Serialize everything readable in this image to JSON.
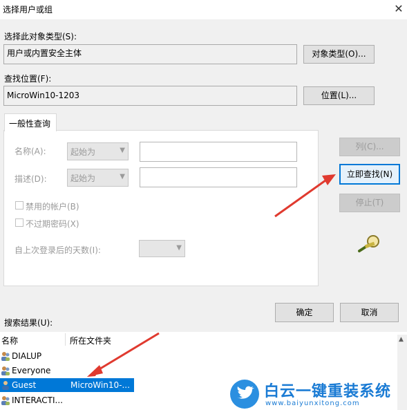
{
  "window": {
    "title": "选择用户或组",
    "close_glyph": "✕"
  },
  "object_type": {
    "label": "选择此对象类型(S):",
    "value": "用户或内置安全主体",
    "button": "对象类型(O)..."
  },
  "location": {
    "label": "查找位置(F):",
    "value": "MicroWin10-1203",
    "button": "位置(L)..."
  },
  "query": {
    "tab_label": "一般性查询",
    "name_label": "名称(A):",
    "name_mode": "起始为",
    "desc_label": "描述(D):",
    "desc_mode": "起始为",
    "disabled_accounts": "禁用的帐户(B)",
    "non_expiring_pw": "不过期密码(X)",
    "days_since_logon": "自上次登录后的天数(I):"
  },
  "side_buttons": {
    "columns": "列(C)...",
    "find_now": "立即查找(N)",
    "stop": "停止(T)"
  },
  "dialog_buttons": {
    "ok": "确定",
    "cancel": "取消"
  },
  "results": {
    "label": "搜索结果(U):",
    "col_name": "名称",
    "col_folder": "所在文件夹",
    "rows": [
      {
        "name": "DIALUP",
        "folder": ""
      },
      {
        "name": "Everyone",
        "folder": ""
      },
      {
        "name": "Guest",
        "folder": "MicroWin10-..."
      },
      {
        "name": "INTERACTI...",
        "folder": ""
      }
    ]
  },
  "watermark": {
    "brand": "白云一键重装系统",
    "url": "www.baiyunxitong.com"
  },
  "colors": {
    "selection": "#0078d7",
    "arrow": "#e03a2f",
    "brand_blue": "#1a7bd4"
  }
}
